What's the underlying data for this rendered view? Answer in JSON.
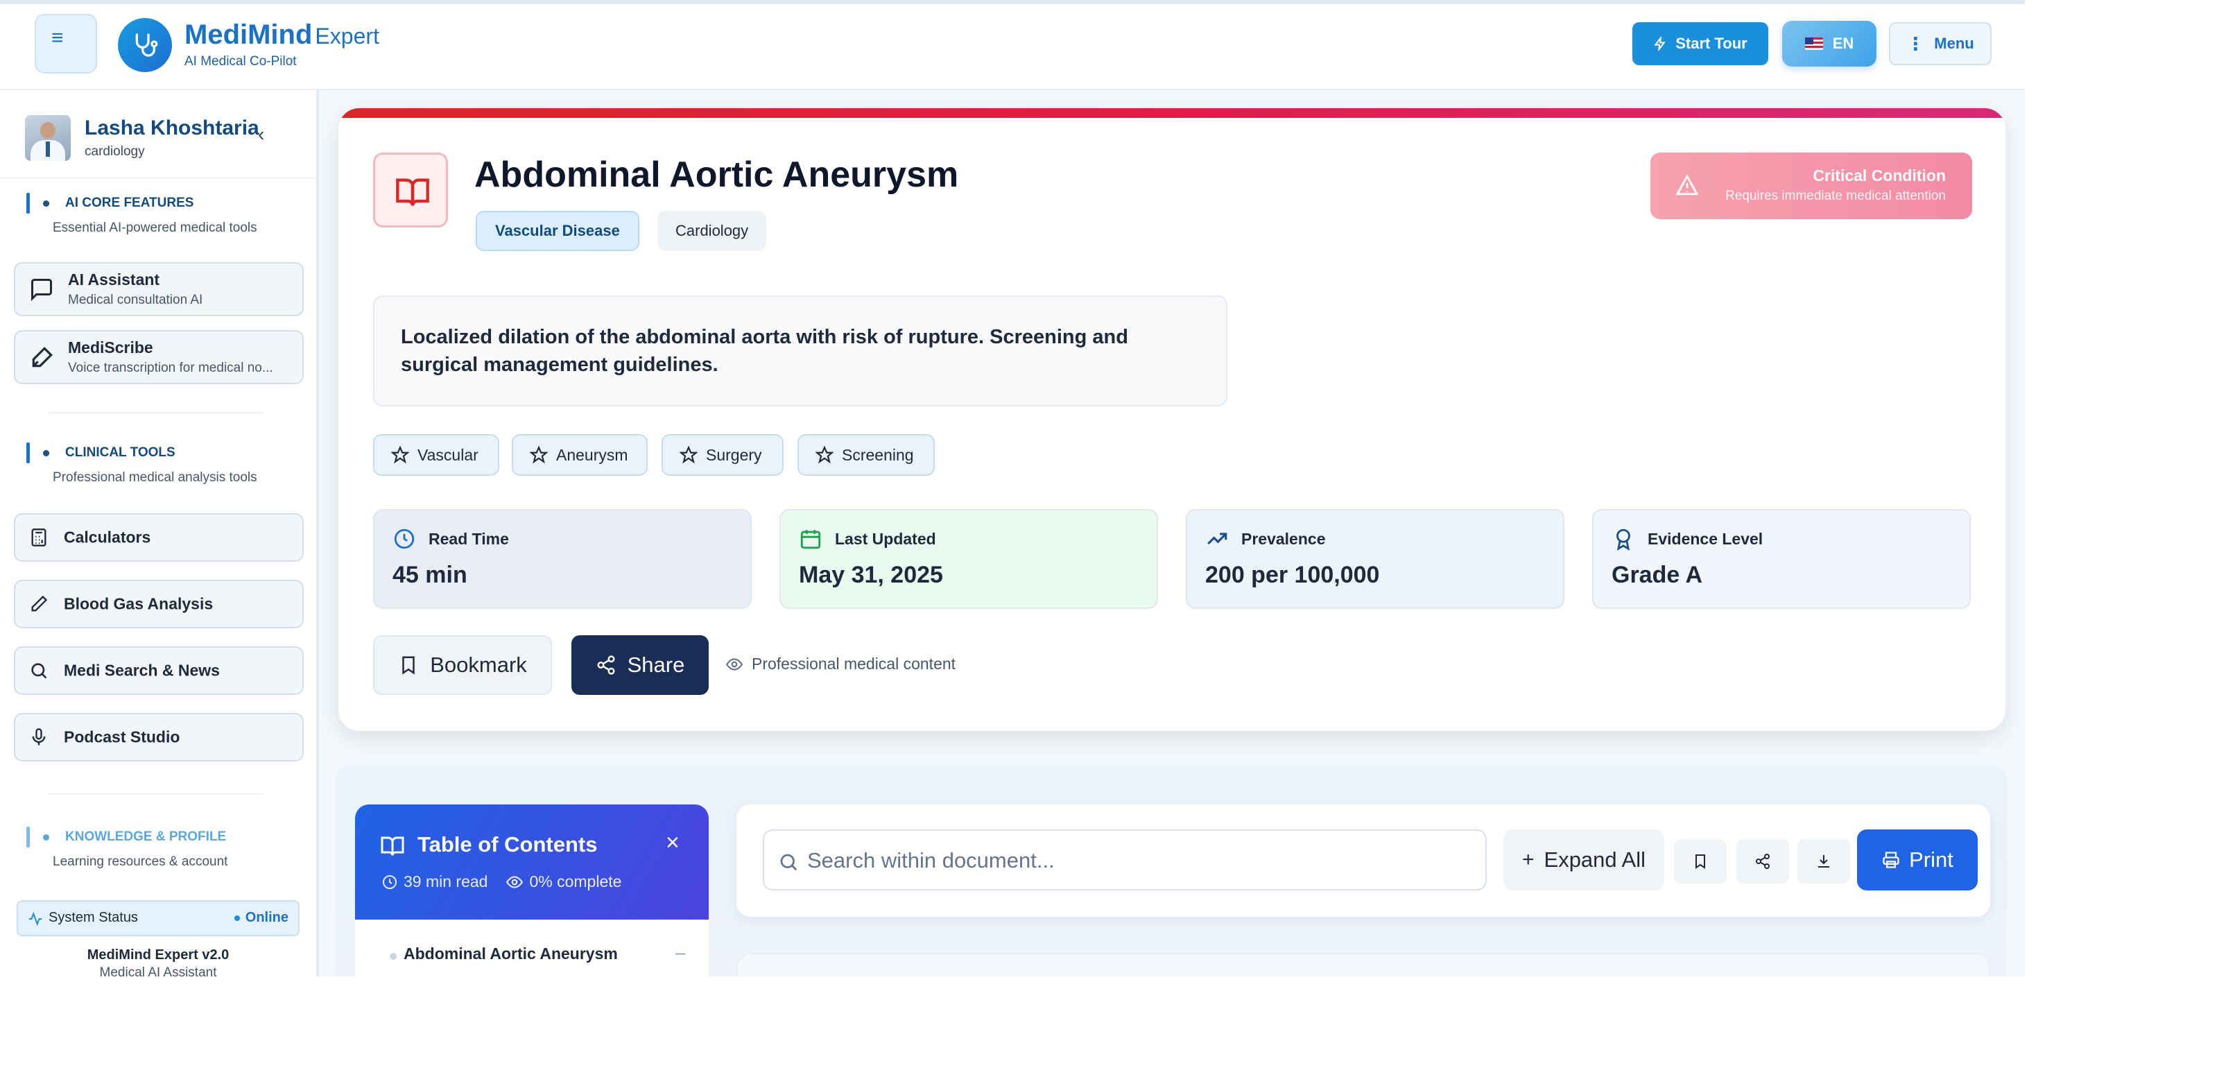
{
  "header": {
    "brand_main": "MediMind",
    "brand_suffix": "Expert",
    "brand_sub": "AI Medical Co-Pilot",
    "start_tour": "Start Tour",
    "lang": "EN",
    "menu": "Menu"
  },
  "sidebar": {
    "profile_name": "Lasha Khoshtaria",
    "profile_spec": "cardiology",
    "sections": [
      {
        "title": "AI CORE FEATURES",
        "subtitle": "Essential AI-powered medical tools"
      },
      {
        "title": "CLINICAL TOOLS",
        "subtitle": "Professional medical analysis tools"
      },
      {
        "title": "KNOWLEDGE & PROFILE",
        "subtitle": "Learning resources & account"
      }
    ],
    "ai_items": [
      {
        "label": "AI Assistant",
        "sub": "Medical consultation AI",
        "icon": "chat-icon"
      },
      {
        "label": "MediScribe",
        "sub": "Voice transcription for medical no...",
        "icon": "pen-icon"
      }
    ],
    "clinical_items": [
      {
        "label": "Calculators",
        "icon": "calculator-icon"
      },
      {
        "label": "Blood Gas Analysis",
        "icon": "pencil-icon"
      },
      {
        "label": "Medi Search & News",
        "icon": "search-icon"
      },
      {
        "label": "Podcast Studio",
        "icon": "microphone-icon"
      }
    ],
    "system_status_label": "System Status",
    "system_status_value": "Online",
    "version": "MediMind Expert v2.0",
    "version_sub": "Medical AI Assistant"
  },
  "article": {
    "title": "Abdominal Aortic Aneurysm",
    "category": "Vascular Disease",
    "specialty": "Cardiology",
    "critical_title": "Critical Condition",
    "critical_sub": "Requires immediate medical attention",
    "description": "Localized dilation of the abdominal aorta with risk of rupture. Screening and surgical management guidelines.",
    "tags": [
      "Vascular",
      "Aneurysm",
      "Surgery",
      "Screening"
    ],
    "stats": [
      {
        "label": "Read Time",
        "value": "45 min",
        "icon": "clock-icon",
        "bg": "#e9eef5",
        "accent": "#1a72c8"
      },
      {
        "label": "Last Updated",
        "value": "May 31, 2025",
        "icon": "calendar-icon",
        "bg": "#eafaf1",
        "accent": "#16a34a"
      },
      {
        "label": "Prevalence",
        "value": "200 per 100,000",
        "icon": "trending-up-icon",
        "bg": "#edf3fb",
        "accent": "#1a4f8a"
      },
      {
        "label": "Evidence Level",
        "value": "Grade A",
        "icon": "award-icon",
        "bg": "#f1f6fc",
        "accent": "#1a4f8a"
      }
    ],
    "bookmark": "Bookmark",
    "share": "Share",
    "professional_note": "Professional medical content"
  },
  "toc": {
    "title": "Table of Contents",
    "read_time": "39 min read",
    "complete": "0% complete",
    "first_item": "Abdominal Aortic Aneurysm",
    "first_item_toggle": "–"
  },
  "search": {
    "placeholder": "Search within document...",
    "expand_all": "Expand All",
    "print": "Print"
  },
  "colors": {
    "brand": "#1a72c8",
    "critical": "#e11d48",
    "toc_header": "#1f63e6",
    "share_button": "#1a2d55"
  }
}
